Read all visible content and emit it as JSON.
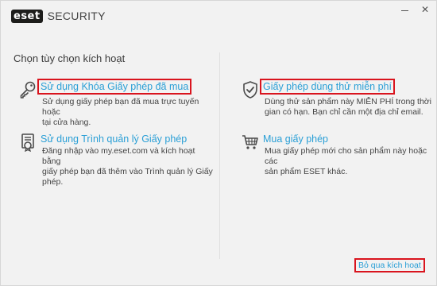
{
  "header": {
    "logo_badge": "eset",
    "logo_text": "SECURITY",
    "minimize_icon": "minimize-icon",
    "close_icon": "close-icon",
    "close_glyph": "✕"
  },
  "main": {
    "title": "Chọn tùy chọn kích hoạt",
    "options": [
      {
        "icon": "key-icon",
        "label": "Sử dụng Khóa Giấy phép đã mua",
        "desc_lines": [
          "Sử dụng giấy phép bạn đã mua trực tuyến hoặc",
          "tại cửa hàng."
        ]
      },
      {
        "icon": "shield-check-icon",
        "label": "Giấy phép dùng thử miễn phí",
        "desc_lines": [
          "Dùng thử sản phẩm này MIỄN PHÍ trong thời",
          "gian có hạn. Bạn chỉ cần một địa chỉ email."
        ]
      },
      {
        "icon": "license-manager-icon",
        "label": "Sử dụng Trình quản lý Giấy phép",
        "desc_lines": [
          "Đăng nhập vào my.eset.com và kích hoạt bằng",
          "giấy phép bạn đã thêm vào Trình quản lý Giấy",
          "phép."
        ]
      },
      {
        "icon": "cart-icon",
        "label": "Mua giấy phép",
        "desc_lines": [
          "Mua giấy phép mới cho sản phẩm này hoặc các",
          "sản phẩm ESET khác."
        ]
      }
    ],
    "skip_label": "Bỏ qua kích hoạt"
  },
  "colors": {
    "link": "#2a9fd6",
    "highlight_box": "#d9141e",
    "background": "#f2f2f2"
  }
}
